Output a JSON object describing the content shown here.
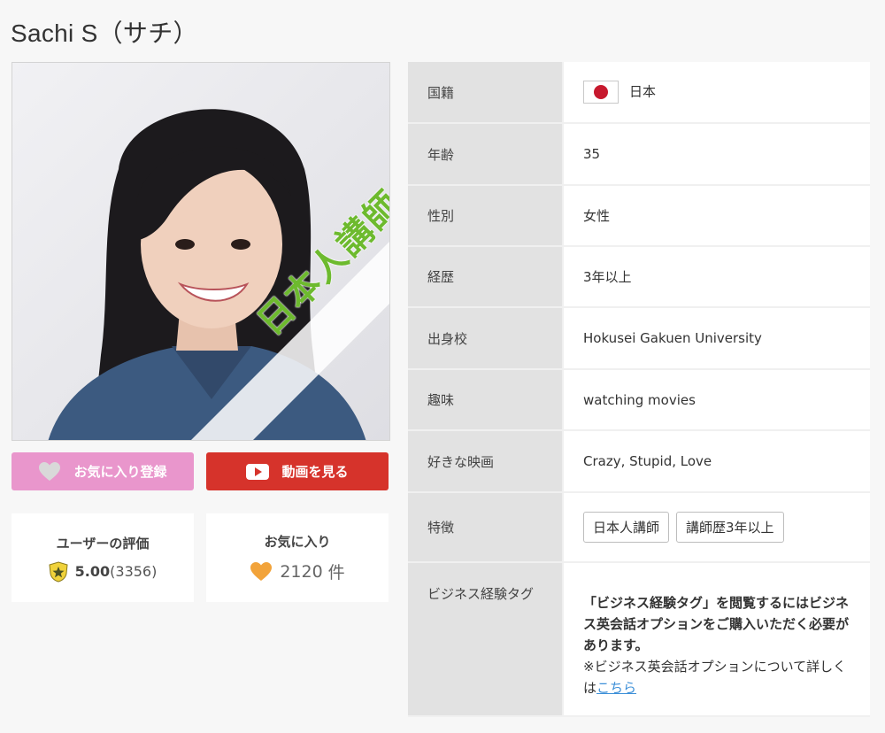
{
  "page": {
    "title": "Sachi S（サチ）"
  },
  "photo": {
    "badge": "日本人講師"
  },
  "buttons": {
    "favorite_label": "お気に入り登録",
    "video_label": "動画を見る"
  },
  "stats": {
    "rating": {
      "label": "ユーザーの評価",
      "score": "5.00",
      "count": "(3356)"
    },
    "favorites": {
      "label": "お気に入り",
      "count": "2120",
      "unit": "件"
    }
  },
  "profile": {
    "nationality": {
      "label": "国籍",
      "value": "日本"
    },
    "age": {
      "label": "年齢",
      "value": "35"
    },
    "gender": {
      "label": "性別",
      "value": "女性"
    },
    "career": {
      "label": "経歴",
      "value": "3年以上"
    },
    "school": {
      "label": "出身校",
      "value": "Hokusei Gakuen University"
    },
    "hobby": {
      "label": "趣味",
      "value": "watching movies"
    },
    "movie": {
      "label": "好きな映画",
      "value": "Crazy, Stupid, Love"
    },
    "features": {
      "label": "特徴",
      "tags": [
        "日本人講師",
        "講師歴3年以上"
      ]
    },
    "business": {
      "label": "ビジネス経験タグ",
      "note_bold": "「ビジネス経験タグ」を閲覧するにはビジネス英会話オプションをご購入いただく必要があります。",
      "note_sub": "※ビジネス英会話オプションについて詳しくは",
      "link_text": "こちら"
    }
  },
  "colors": {
    "favorite_button": "#e996cc",
    "video_button": "#d6332b",
    "badge_green": "#6dba2e",
    "link": "#3c8fd8",
    "label_bg": "#e2e2e2"
  },
  "icons": {
    "favorite_button": "heart-icon",
    "video_button": "play-icon",
    "rating": "star-shield-icon",
    "favorites": "heart-icon",
    "nationality": "japan-flag-icon"
  }
}
